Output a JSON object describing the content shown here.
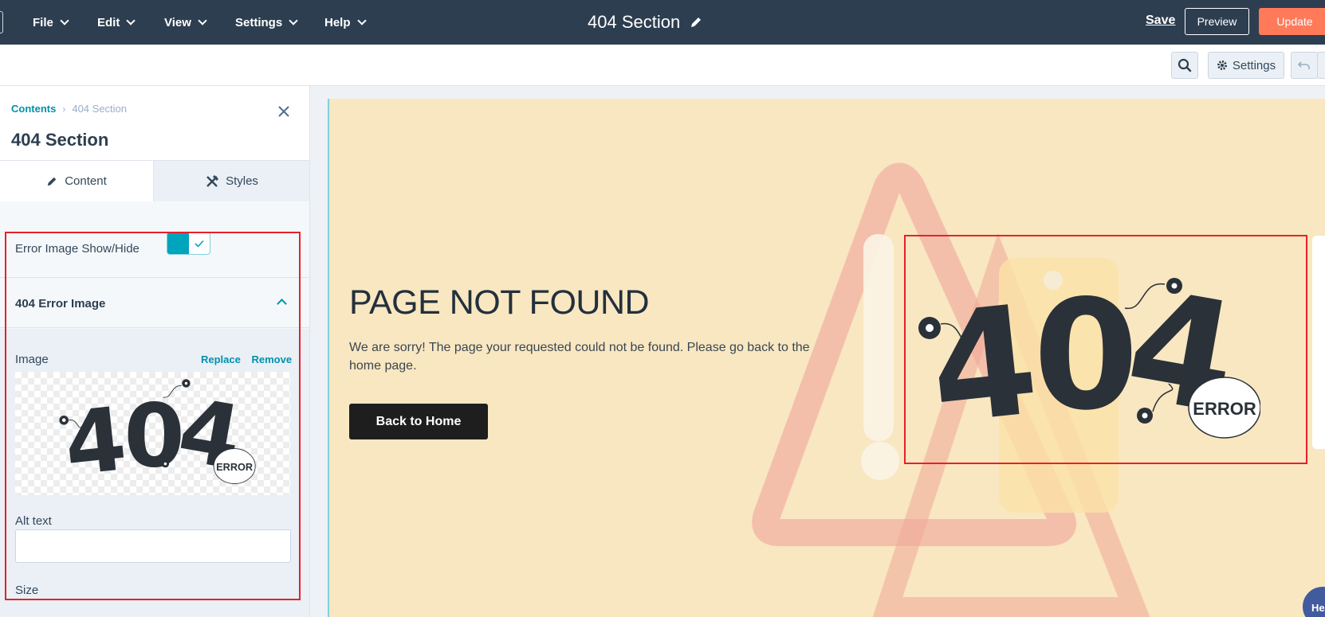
{
  "menu": {
    "items": [
      {
        "label": "File"
      },
      {
        "label": "Edit"
      },
      {
        "label": "View"
      },
      {
        "label": "Settings"
      },
      {
        "label": "Help"
      }
    ],
    "doc_title": "404 Section",
    "save_label": "Save",
    "preview_label": "Preview",
    "update_label": "Update"
  },
  "toolbar": {
    "settings_label": "Settings",
    "icons": [
      "search-icon",
      "gear-icon",
      "undo-icon"
    ]
  },
  "sidebar": {
    "breadcrumb": {
      "parent": "Contents",
      "separator": "›",
      "current": "404 Section"
    },
    "title": "404 Section",
    "tabs": [
      {
        "label": "Content",
        "active": true
      },
      {
        "label": "Styles",
        "active": false
      }
    ],
    "toggle_label": "Error Image Show/Hide",
    "toggle_on": true,
    "accordion_label": "404 Error Image",
    "image_label": "Image",
    "replace_label": "Replace",
    "remove_label": "Remove",
    "alt_label": "Alt text",
    "alt_value": "",
    "size_label": "Size"
  },
  "preview": {
    "heading": "PAGE NOT FOUND",
    "body": "We are sorry! The page your requested could not be found. Please go back to the home page.",
    "button": "Back to Home",
    "image_digits": "404",
    "image_badge": "ERROR"
  },
  "help": {
    "label": "He"
  },
  "colors": {
    "topbar": "#2d3e50",
    "accent": "#0091ae",
    "update": "#ff7a59",
    "toggle": "#00a4bd",
    "highlight": "#e8202a",
    "canvas_bg": "#f8e7c1"
  }
}
